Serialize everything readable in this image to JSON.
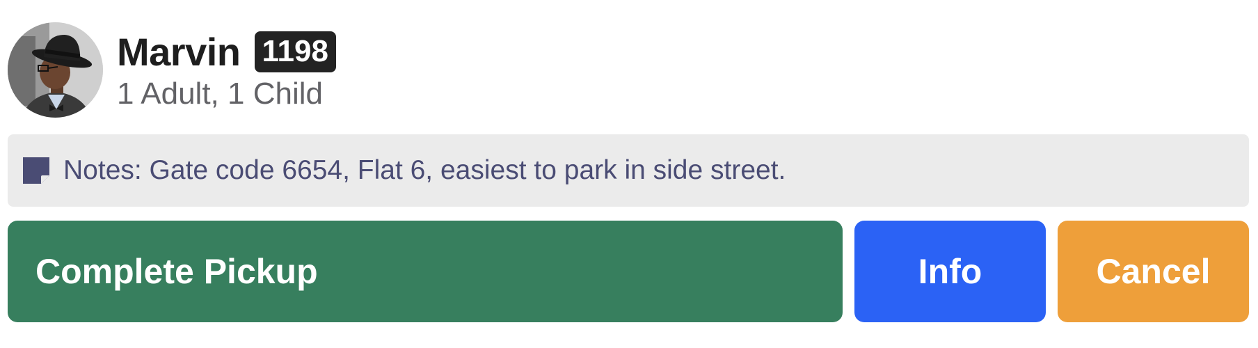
{
  "passenger": {
    "name": "Marvin",
    "id_badge": "1198",
    "party_size": "1 Adult, 1 Child",
    "avatar_icon": "person-avatar-photo"
  },
  "notes": {
    "icon": "sticky-note-icon",
    "text": "Notes: Gate code 6654, Flat 6, easiest to park in side street."
  },
  "actions": {
    "complete_label": "Complete Pickup",
    "info_label": "Info",
    "cancel_label": "Cancel"
  },
  "colors": {
    "complete": "#377f5e",
    "info": "#2b62f5",
    "cancel": "#ee9f3a",
    "notes_background": "#ebebeb",
    "notes_text": "#4a4c74",
    "badge": "#232323"
  }
}
